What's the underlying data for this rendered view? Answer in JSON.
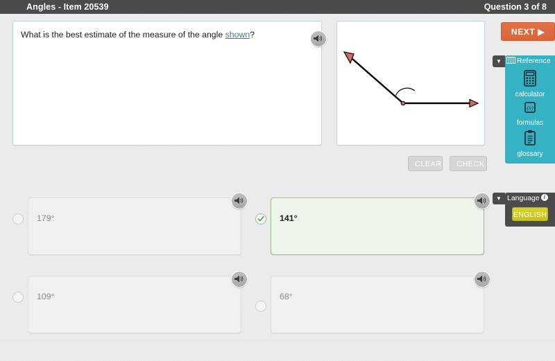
{
  "header": {
    "title": "Angles - Item 20539",
    "question_counter": "Question 3 of 8"
  },
  "question": {
    "text_before_link": "What is the best estimate of the measure of the angle ",
    "link_text": "shown",
    "text_after_link": "?",
    "speaker_icon": "speaker-icon"
  },
  "figure": {
    "type": "angle-diagram",
    "description": "An angle with vertex at center, one ray pointing right and one ray pointing up-left, with an arc marking the angle",
    "vertex_color": "#d4686b",
    "ray_color": "#000000",
    "arrow_fill": "#d4686b"
  },
  "actions": {
    "clear_label": "CLEAR",
    "check_label": "CHECK",
    "disabled_color": "#d6d6d6"
  },
  "options": [
    {
      "id": "a",
      "label": "179°",
      "selected": false,
      "speaker_icon": "speaker-icon"
    },
    {
      "id": "b",
      "label": "141°",
      "selected": true,
      "speaker_icon": "speaker-icon"
    },
    {
      "id": "c",
      "label": "109°",
      "selected": false,
      "speaker_icon": "speaker-icon"
    },
    {
      "id": "d",
      "label": "68°",
      "selected": false,
      "speaker_icon": "speaker-icon"
    }
  ],
  "sidebar": {
    "next_label": "NEXT ▶",
    "next_color": "#d9663a",
    "reference": {
      "collapse_glyph": "▼",
      "title": "Reference",
      "accent_color": "#35b3c4",
      "items": [
        {
          "icon": "calculator-icon",
          "label": "calculator"
        },
        {
          "icon": "formulas-icon",
          "label": "formulas"
        },
        {
          "icon": "glossary-icon",
          "label": "glossary"
        }
      ]
    },
    "language": {
      "collapse_glyph": "▼",
      "title": "Language",
      "info_glyph": "i",
      "button_label": "ENGLISH",
      "button_color": "#c9c31f"
    }
  }
}
